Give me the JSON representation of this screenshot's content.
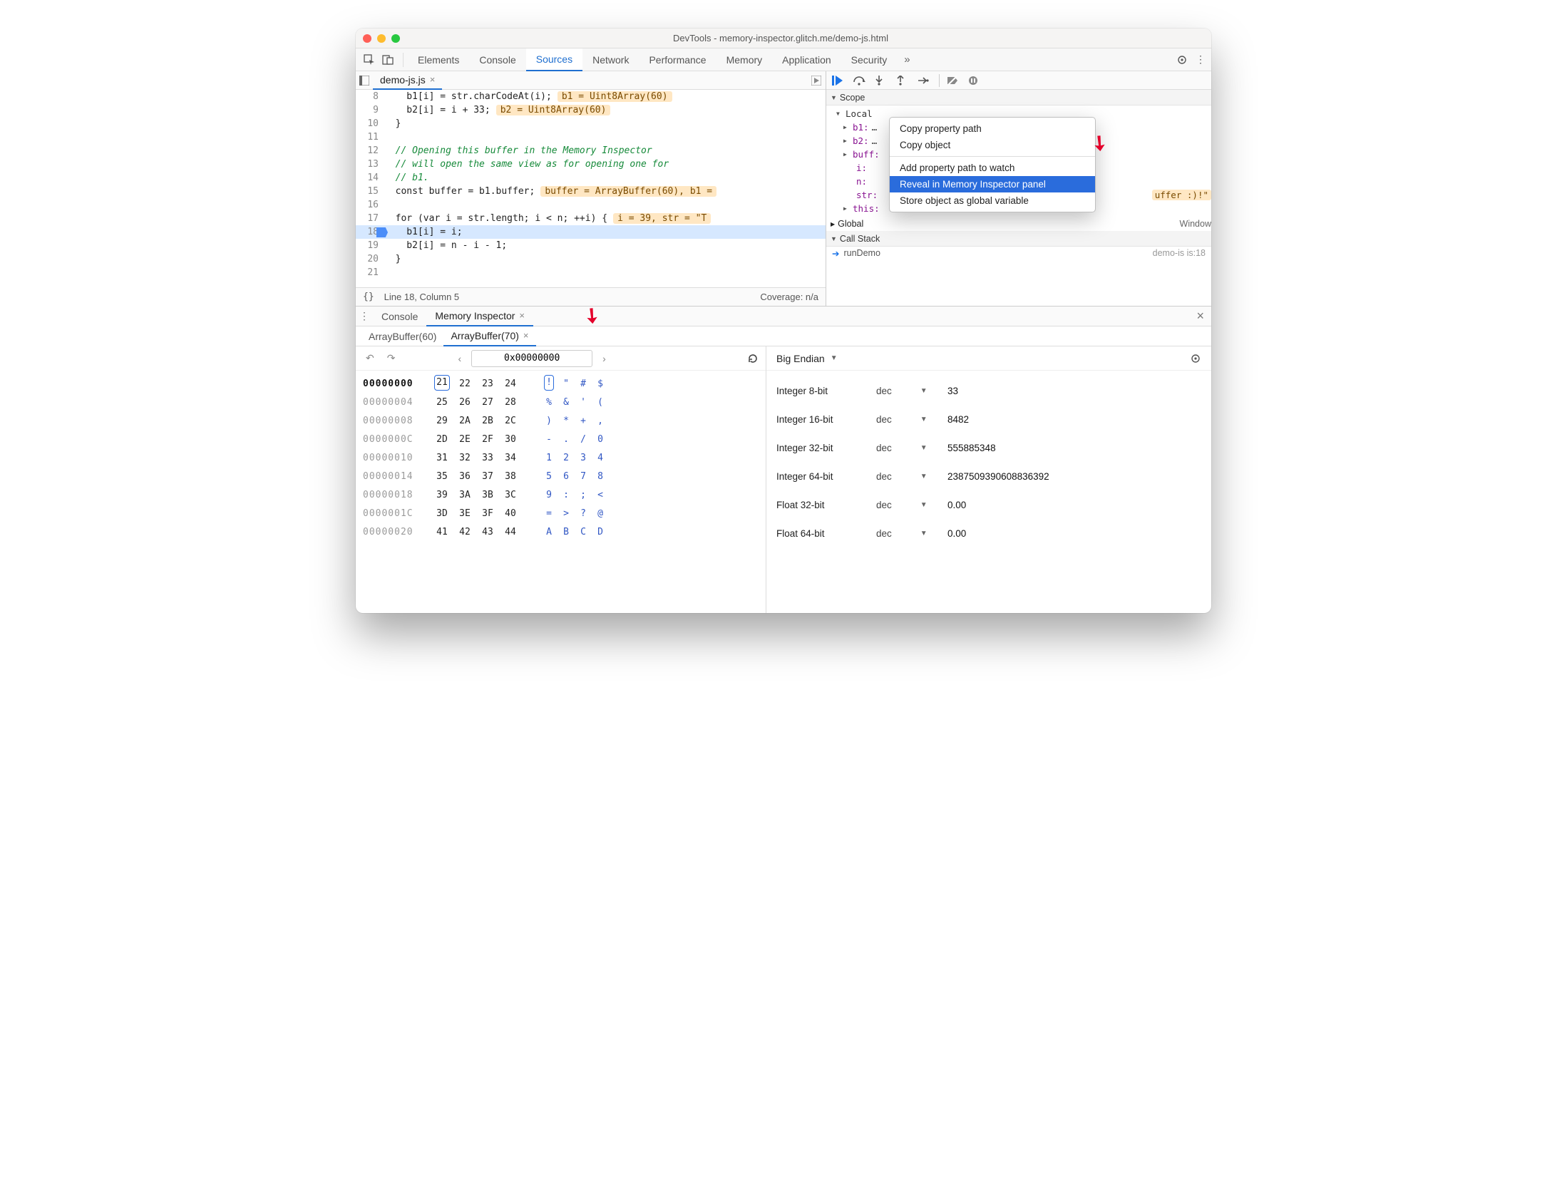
{
  "titlebar": {
    "title": "DevTools - memory-inspector.glitch.me/demo-js.html"
  },
  "tabs": {
    "items": [
      "Elements",
      "Console",
      "Sources",
      "Network",
      "Performance",
      "Memory",
      "Application",
      "Security"
    ],
    "active": "Sources",
    "overflow": "»"
  },
  "sources": {
    "filename": "demo-js.js",
    "lines": [
      {
        "n": 8,
        "text": "    b1[i] = str.charCodeAt(i);",
        "tip": "b1 = Uint8Array(60)"
      },
      {
        "n": 9,
        "text": "    b2[i] = i + 33;",
        "tip": "b2 = Uint8Array(60)"
      },
      {
        "n": 10,
        "text": "  }"
      },
      {
        "n": 11,
        "text": ""
      },
      {
        "n": 12,
        "text": "  // Opening this buffer in the Memory Inspector",
        "comment": true
      },
      {
        "n": 13,
        "text": "  // will open the same view as for opening one for",
        "comment": true
      },
      {
        "n": 14,
        "text": "  // b1.",
        "comment": true
      },
      {
        "n": 15,
        "text": "  const buffer = b1.buffer;",
        "tip": "buffer = ArrayBuffer(60), b1 ="
      },
      {
        "n": 16,
        "text": ""
      },
      {
        "n": 17,
        "text": "  for (var i = str.length; i < n; ++i) {",
        "tip": "i = 39, str = \"T"
      },
      {
        "n": 18,
        "text": "    b1[i] = i;",
        "current": true
      },
      {
        "n": 19,
        "text": "    b2[i] = n - i - 1;"
      },
      {
        "n": 20,
        "text": "  }"
      },
      {
        "n": 21,
        "text": ""
      }
    ],
    "status_left": "Line 18, Column 5",
    "status_right": "Coverage: n/a",
    "braces": "{}"
  },
  "debugger": {
    "scope_label": "Scope",
    "local_label": "Local",
    "vars": [
      {
        "name": "b1",
        "val": "…"
      },
      {
        "name": "b2",
        "val": "…"
      },
      {
        "name": "buff",
        "val": ""
      },
      {
        "name": "i",
        "val": "",
        "sub": true
      },
      {
        "name": "n",
        "val": "",
        "sub": true
      },
      {
        "name": "str",
        "val": "",
        "sub": true,
        "inline": "uffer :)!\""
      },
      {
        "name": "this",
        "val": "",
        "sub": false
      }
    ],
    "global_label": "Global",
    "global_val": "Window",
    "callstack_label": "Call Stack",
    "callstack_fn": "runDemo",
    "callstack_loc": "demo-is is:18"
  },
  "context_menu": {
    "items": [
      "Copy property path",
      "Copy object",
      "Add property path to watch",
      "Reveal in Memory Inspector panel",
      "Store object as global variable"
    ],
    "selected_index": 3
  },
  "drawer": {
    "tabs": [
      "Console",
      "Memory Inspector"
    ],
    "active": "Memory Inspector"
  },
  "memory_inspector": {
    "buffers": [
      "ArrayBuffer(60)",
      "ArrayBuffer(70)"
    ],
    "active_buffer": "ArrayBuffer(70)",
    "address": "0x00000000",
    "endian": "Big Endian",
    "hex": [
      {
        "addr": "00000000",
        "bytes": [
          "21",
          "22",
          "23",
          "24"
        ],
        "ascii": [
          "!",
          "\"",
          "#",
          "$"
        ],
        "first": true,
        "sel": 0
      },
      {
        "addr": "00000004",
        "bytes": [
          "25",
          "26",
          "27",
          "28"
        ],
        "ascii": [
          "%",
          "&",
          "'",
          "("
        ]
      },
      {
        "addr": "00000008",
        "bytes": [
          "29",
          "2A",
          "2B",
          "2C"
        ],
        "ascii": [
          ")",
          "*",
          "+",
          ","
        ]
      },
      {
        "addr": "0000000C",
        "bytes": [
          "2D",
          "2E",
          "2F",
          "30"
        ],
        "ascii": [
          "-",
          ".",
          "/",
          "0"
        ]
      },
      {
        "addr": "00000010",
        "bytes": [
          "31",
          "32",
          "33",
          "34"
        ],
        "ascii": [
          "1",
          "2",
          "3",
          "4"
        ]
      },
      {
        "addr": "00000014",
        "bytes": [
          "35",
          "36",
          "37",
          "38"
        ],
        "ascii": [
          "5",
          "6",
          "7",
          "8"
        ]
      },
      {
        "addr": "00000018",
        "bytes": [
          "39",
          "3A",
          "3B",
          "3C"
        ],
        "ascii": [
          "9",
          ":",
          ";",
          "<"
        ]
      },
      {
        "addr": "0000001C",
        "bytes": [
          "3D",
          "3E",
          "3F",
          "40"
        ],
        "ascii": [
          "=",
          ">",
          "?",
          "@"
        ]
      },
      {
        "addr": "00000020",
        "bytes": [
          "41",
          "42",
          "43",
          "44"
        ],
        "ascii": [
          "A",
          "B",
          "C",
          "D"
        ]
      }
    ],
    "values": [
      {
        "type": "Integer 8-bit",
        "mode": "dec",
        "val": "33"
      },
      {
        "type": "Integer 16-bit",
        "mode": "dec",
        "val": "8482"
      },
      {
        "type": "Integer 32-bit",
        "mode": "dec",
        "val": "555885348"
      },
      {
        "type": "Integer 64-bit",
        "mode": "dec",
        "val": "2387509390608836392"
      },
      {
        "type": "Float 32-bit",
        "mode": "dec",
        "val": "0.00"
      },
      {
        "type": "Float 64-bit",
        "mode": "dec",
        "val": "0.00"
      }
    ]
  }
}
